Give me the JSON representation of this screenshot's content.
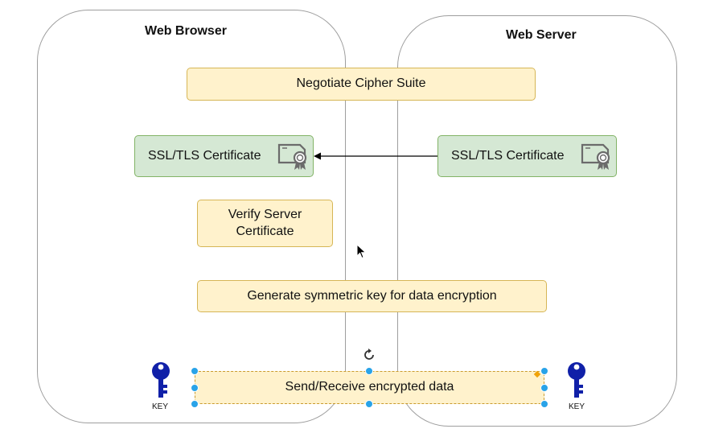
{
  "lanes": {
    "browser_title": "Web Browser",
    "server_title": "Web Server"
  },
  "steps": {
    "negotiate": "Negotiate Cipher Suite",
    "browser_cert": "SSL/TLS Certificate",
    "server_cert": "SSL/TLS Certificate",
    "verify": "Verify Server Certificate",
    "generate": "Generate symmetric key for data encryption",
    "send_receive": "Send/Receive encrypted data"
  },
  "keys": {
    "left_label": "KEY",
    "right_label": "KEY"
  },
  "colors": {
    "yellow_fill": "#fff2cc",
    "yellow_stroke": "#d6b656",
    "green_fill": "#d5e8d4",
    "green_stroke": "#82b366",
    "key_blue": "#1020a8",
    "selection_handle": "#29a3e8",
    "lane_border": "#9e9e9e"
  },
  "icons": [
    "certificate-icon",
    "key-icon",
    "rotate-icon",
    "cursor-arrow-icon"
  ]
}
